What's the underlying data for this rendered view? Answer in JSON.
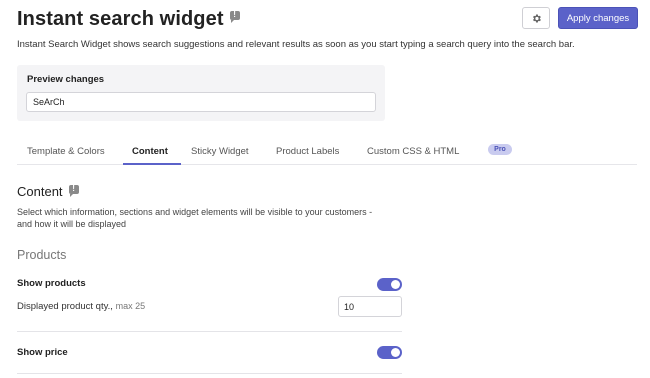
{
  "header": {
    "title": "Instant search widget",
    "apply_label": "Apply changes",
    "description": "Instant Search Widget shows search suggestions and relevant results as soon as you start typing a search query into the search bar."
  },
  "preview": {
    "label": "Preview changes",
    "value": "SeArCh"
  },
  "tabs": [
    {
      "label": "Template & Colors"
    },
    {
      "label": "Content"
    },
    {
      "label": "Sticky Widget"
    },
    {
      "label": "Product Labels"
    },
    {
      "label": "Custom CSS & HTML"
    }
  ],
  "pro_badge": "Pro",
  "content": {
    "title": "Content",
    "description": "Select which information, sections and widget elements will be visible to your customers - and how it will be displayed"
  },
  "products": {
    "title": "Products",
    "show_products_label": "Show products",
    "show_products_enabled": true,
    "qty_label": "Displayed product qty.,",
    "qty_hint": "max 25",
    "qty_value": "10",
    "show_price_label": "Show price",
    "show_price_enabled": true
  },
  "colors": {
    "accent": "#5b62c9",
    "badge_bg": "#c9cbef"
  }
}
